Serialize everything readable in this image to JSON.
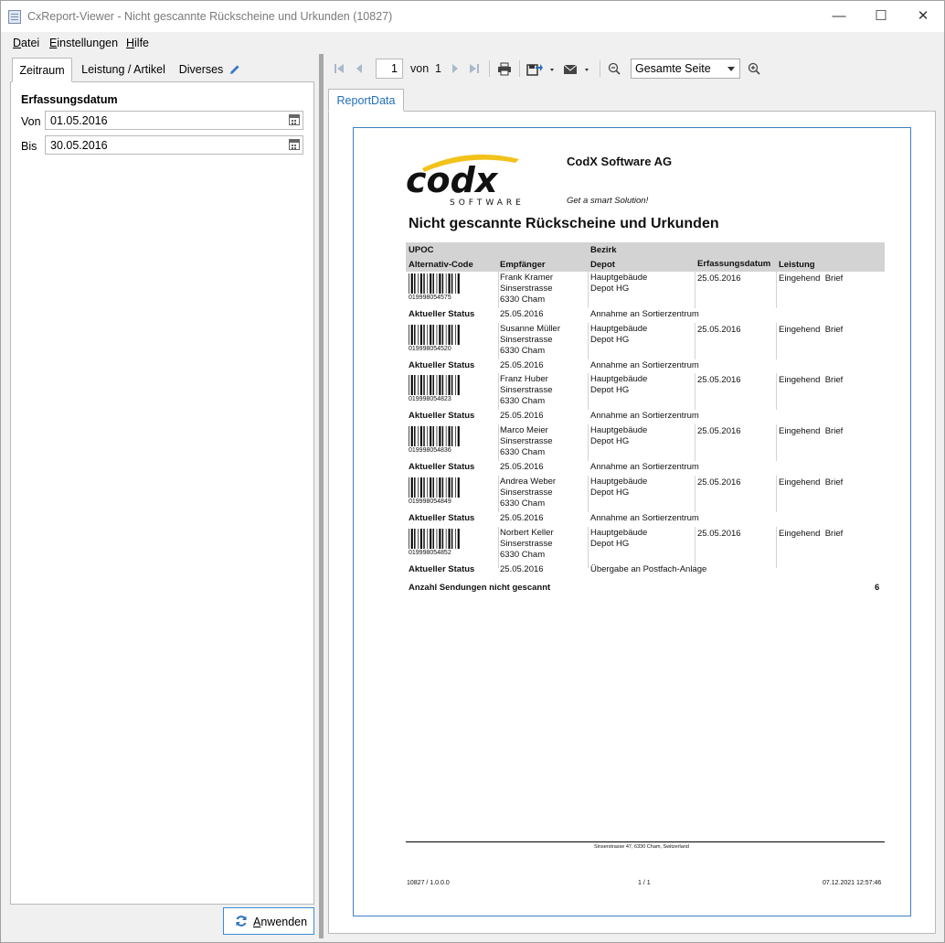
{
  "window": {
    "title": "CxReport-Viewer - Nicht gescannte Rückscheine und Urkunden (10827)",
    "minimize": "—",
    "maximize": "☐",
    "close": "✕"
  },
  "menu": {
    "datei_key": "D",
    "datei_rest": "atei",
    "einstellungen_key": "E",
    "einstellungen_rest": "instellungen",
    "hilfe_key": "H",
    "hilfe_rest": "ilfe"
  },
  "left": {
    "tabs": [
      "Zeitraum",
      "Leistung / Artikel",
      "Diverses"
    ],
    "section_title": "Erfassungsdatum",
    "von_label": "Von",
    "von_value": "01.05.2016",
    "bis_label": "Bis",
    "bis_value": "30.05.2016",
    "apply_key": "A",
    "apply_rest": "nwenden"
  },
  "toolbar": {
    "page": "1",
    "of_label": "von",
    "total": "1",
    "zoom": "Gesamte Seite"
  },
  "report_tab": "ReportData",
  "report": {
    "company": "CodX Software AG",
    "slogan": "Get a smart Solution!",
    "logo_text": "codx",
    "logo_sub": "SOFTWARE",
    "title": "Nicht gescannte Rückscheine und Urkunden",
    "headers": {
      "upoc": "UPOC",
      "alt_code": "Alternativ-Code",
      "empfaenger": "Empfänger",
      "bezirk": "Bezirk",
      "depot": "Depot",
      "erfassungsdatum": "Erfassungsdatum",
      "leistung": "Leistung"
    },
    "status_label": "Aktueller Status",
    "rows": [
      {
        "code": "019998054575",
        "name": "Frank Kramer",
        "street": "Sinserstrasse",
        "city": "6330 Cham",
        "bezirk": "Hauptgebäude",
        "depot": "Depot HG",
        "datum": "25.05.2016",
        "leistung": "Eingehend  Brief",
        "status_date": "25.05.2016",
        "status": "Annahme an Sortierzentrum"
      },
      {
        "code": "019998054520",
        "name": "Susanne Müller",
        "street": "Sinserstrasse",
        "city": "6330 Cham",
        "bezirk": "Hauptgebäude",
        "depot": "Depot HG",
        "datum": "25.05.2016",
        "leistung": "Eingehend  Brief",
        "status_date": "25.05.2016",
        "status": "Annahme an Sortierzentrum"
      },
      {
        "code": "019998054823",
        "name": "Franz Huber",
        "street": "Sinserstrasse",
        "city": "6330 Cham",
        "bezirk": "Hauptgebäude",
        "depot": "Depot HG",
        "datum": "25.05.2016",
        "leistung": "Eingehend  Brief",
        "status_date": "25.05.2016",
        "status": "Annahme an Sortierzentrum"
      },
      {
        "code": "019998054836",
        "name": "Marco Meier",
        "street": "Sinserstrasse",
        "city": "6330 Cham",
        "bezirk": "Hauptgebäude",
        "depot": "Depot HG",
        "datum": "25.05.2016",
        "leistung": "Eingehend  Brief",
        "status_date": "25.05.2016",
        "status": "Annahme an Sortierzentrum"
      },
      {
        "code": "019998054849",
        "name": "Andrea Weber",
        "street": "Sinserstrasse",
        "city": "6330 Cham",
        "bezirk": "Hauptgebäude",
        "depot": "Depot HG",
        "datum": "25.05.2016",
        "leistung": "Eingehend  Brief",
        "status_date": "25.05.2016",
        "status": "Annahme an Sortierzentrum"
      },
      {
        "code": "019998054852",
        "name": "Norbert Keller",
        "street": "Sinserstrasse",
        "city": "6330 Cham",
        "bezirk": "Hauptgebäude",
        "depot": "Depot HG",
        "datum": "25.05.2016",
        "leistung": "Eingehend  Brief",
        "status_date": "25.05.2016",
        "status": "Übergabe an Postfach-Anlage"
      }
    ],
    "total_label": "Anzahl Sendungen nicht gescannt",
    "total_value": "6",
    "footer_address": "Sinserstrasse 47,  6330 Cham,  Switzerland",
    "footer_version": "10827 / 1.0.0.0",
    "footer_page": "1 / 1",
    "footer_timestamp": "07.12.2021 12:57:46"
  }
}
